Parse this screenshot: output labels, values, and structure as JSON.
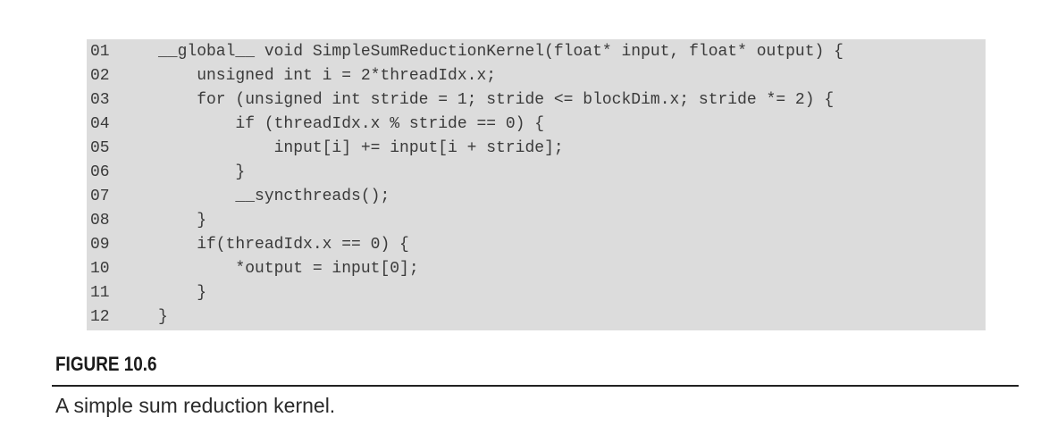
{
  "code": {
    "lines": [
      {
        "num": "01",
        "text": "__global__ void SimpleSumReductionKernel(float* input, float* output) {"
      },
      {
        "num": "02",
        "text": "    unsigned int i = 2*threadIdx.x;"
      },
      {
        "num": "03",
        "text": "    for (unsigned int stride = 1; stride <= blockDim.x; stride *= 2) {"
      },
      {
        "num": "04",
        "text": "        if (threadIdx.x % stride == 0) {"
      },
      {
        "num": "05",
        "text": "            input[i] += input[i + stride];"
      },
      {
        "num": "06",
        "text": "        }"
      },
      {
        "num": "07",
        "text": "        __syncthreads();"
      },
      {
        "num": "08",
        "text": "    }"
      },
      {
        "num": "09",
        "text": "    if(threadIdx.x == 0) {"
      },
      {
        "num": "10",
        "text": "        *output = input[0];"
      },
      {
        "num": "11",
        "text": "    }"
      },
      {
        "num": "12",
        "text": "}"
      }
    ]
  },
  "figure": {
    "label": "FIGURE 10.6",
    "caption": "A simple sum reduction kernel."
  }
}
